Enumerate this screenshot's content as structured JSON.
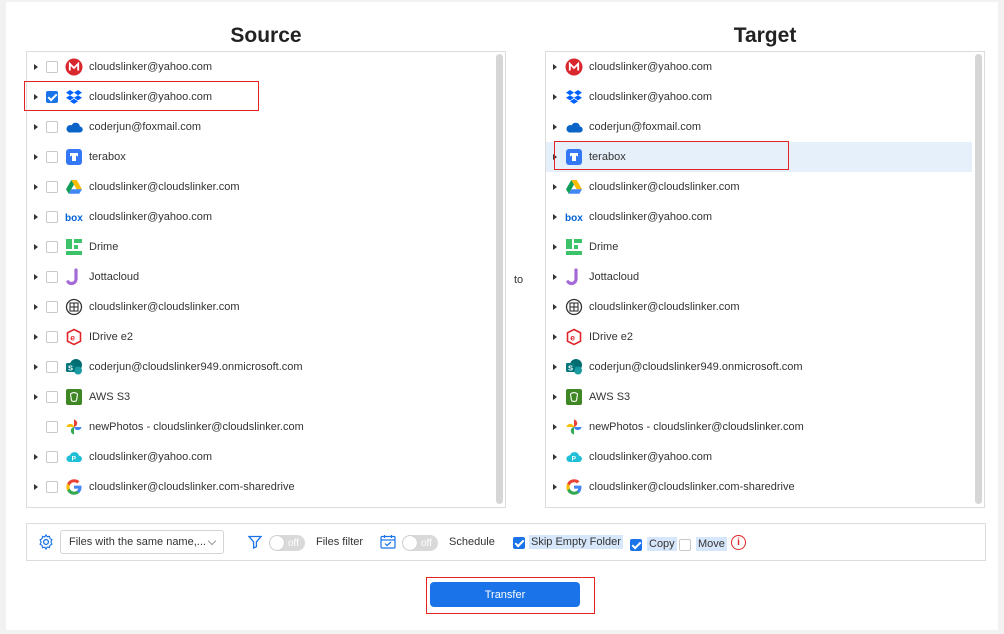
{
  "source": {
    "title": "Source",
    "items": [
      {
        "label": "cloudslinker@yahoo.com",
        "icon": "mega-icon",
        "checked": false,
        "expandable": true
      },
      {
        "label": "cloudslinker@yahoo.com",
        "icon": "dropbox-icon",
        "checked": true,
        "expandable": true
      },
      {
        "label": "coderjun@foxmail.com",
        "icon": "onedrive-icon",
        "checked": false,
        "expandable": true
      },
      {
        "label": "terabox",
        "icon": "terabox-icon",
        "checked": false,
        "expandable": true
      },
      {
        "label": "cloudslinker@cloudslinker.com",
        "icon": "google-drive-icon",
        "checked": false,
        "expandable": true
      },
      {
        "label": "cloudslinker@yahoo.com",
        "icon": "box-icon",
        "checked": false,
        "expandable": true
      },
      {
        "label": "Drime",
        "icon": "drime-icon",
        "checked": false,
        "expandable": true
      },
      {
        "label": "Jottacloud",
        "icon": "jottacloud-icon",
        "checked": false,
        "expandable": true
      },
      {
        "label": "cloudslinker@cloudslinker.com",
        "icon": "webdav-icon",
        "checked": false,
        "expandable": true
      },
      {
        "label": "IDrive e2",
        "icon": "idrive-icon",
        "checked": false,
        "expandable": true
      },
      {
        "label": "coderjun@cloudslinker949.onmicrosoft.com",
        "icon": "sharepoint-icon",
        "checked": false,
        "expandable": true
      },
      {
        "label": "AWS S3",
        "icon": "aws-s3-icon",
        "checked": false,
        "expandable": true
      },
      {
        "label": "newPhotos - cloudslinker@cloudslinker.com",
        "icon": "google-photos-icon",
        "checked": false,
        "expandable": false
      },
      {
        "label": "cloudslinker@yahoo.com",
        "icon": "pcloud-icon",
        "checked": false,
        "expandable": true
      },
      {
        "label": "cloudslinker@cloudslinker.com-sharedrive",
        "icon": "google-icon",
        "checked": false,
        "expandable": true
      }
    ]
  },
  "connector": "to",
  "target": {
    "title": "Target",
    "selected_index": 3,
    "items": [
      {
        "label": "cloudslinker@yahoo.com",
        "icon": "mega-icon"
      },
      {
        "label": "cloudslinker@yahoo.com",
        "icon": "dropbox-icon"
      },
      {
        "label": "coderjun@foxmail.com",
        "icon": "onedrive-icon"
      },
      {
        "label": "terabox",
        "icon": "terabox-icon"
      },
      {
        "label": "cloudslinker@cloudslinker.com",
        "icon": "google-drive-icon"
      },
      {
        "label": "cloudslinker@yahoo.com",
        "icon": "box-icon"
      },
      {
        "label": "Drime",
        "icon": "drime-icon"
      },
      {
        "label": "Jottacloud",
        "icon": "jottacloud-icon"
      },
      {
        "label": "cloudslinker@cloudslinker.com",
        "icon": "webdav-icon"
      },
      {
        "label": "IDrive e2",
        "icon": "idrive-icon"
      },
      {
        "label": "coderjun@cloudslinker949.onmicrosoft.com",
        "icon": "sharepoint-icon"
      },
      {
        "label": "AWS S3",
        "icon": "aws-s3-icon"
      },
      {
        "label": "newPhotos - cloudslinker@cloudslinker.com",
        "icon": "google-photos-icon"
      },
      {
        "label": "cloudslinker@yahoo.com",
        "icon": "pcloud-icon"
      },
      {
        "label": "cloudslinker@cloudslinker.com-sharedrive",
        "icon": "google-icon"
      }
    ]
  },
  "options": {
    "conflict_select": "Files with the same name,...",
    "files_filter": {
      "toggle": "off",
      "label": "Files filter"
    },
    "schedule": {
      "toggle": "off",
      "label": "Schedule"
    },
    "skip_empty_folder": {
      "label": "Skip Empty Folder",
      "checked": true
    },
    "copy": {
      "label": "Copy",
      "checked": true
    },
    "move": {
      "label": "Move",
      "checked": false
    },
    "info_glyph": "i"
  },
  "transfer_button": "Transfer",
  "colors": {
    "accent": "#1a73e8",
    "highlight": "#e02424",
    "selected_row": "#e6f0fb"
  }
}
